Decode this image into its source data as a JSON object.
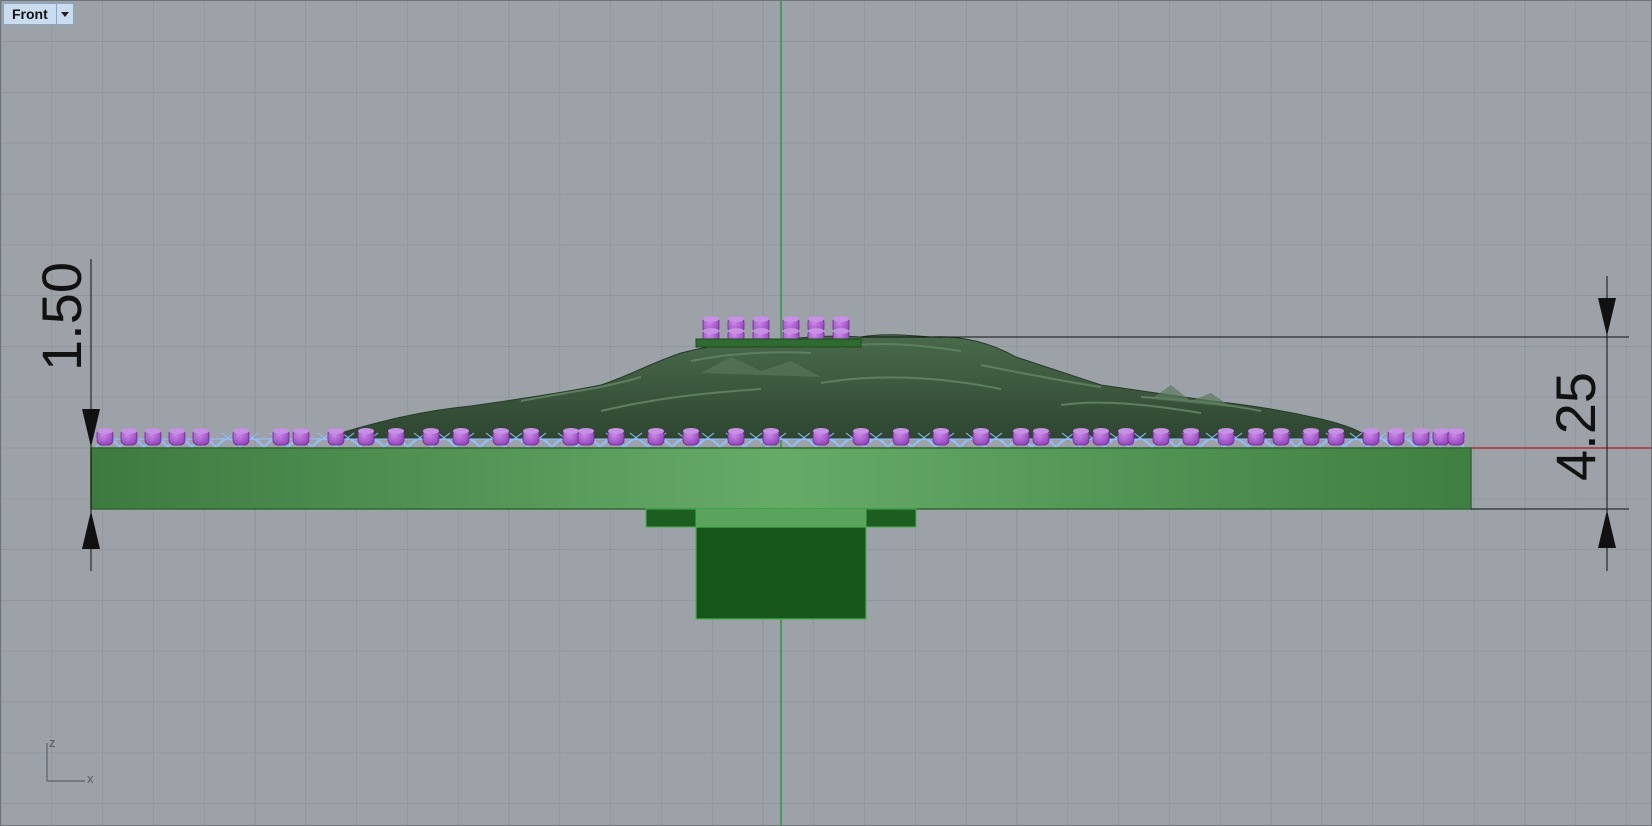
{
  "viewport": {
    "title": "Front",
    "background": "#9ca2a8",
    "grid_color": "#8d9399",
    "axis_x_color": "#b03030",
    "axis_z_color": "#2a9a3a"
  },
  "dimensions": {
    "left_value": "1.50",
    "right_value": "4.25"
  },
  "axis_widget": {
    "vertical_label": "z",
    "horizontal_label": "x"
  },
  "colors": {
    "base_plate": "#4f9a50",
    "base_plate_highlight": "#64a968",
    "stand": "#16561a",
    "terrain": "#3e5a40",
    "supports": "#a84fd4",
    "lattice": "#8fc1ff"
  }
}
